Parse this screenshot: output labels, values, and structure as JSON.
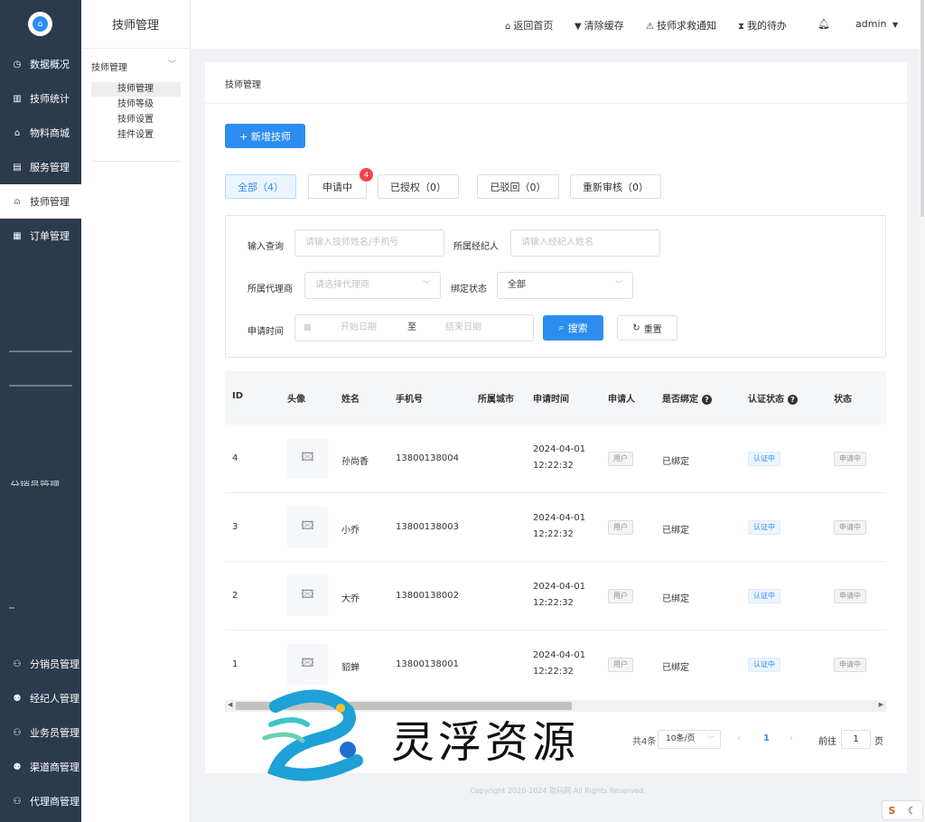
{
  "sidebar": {
    "items": [
      {
        "icon": "dashboard-icon",
        "glyph": "◷",
        "label": "数据概况"
      },
      {
        "icon": "stats-icon",
        "glyph": "▥",
        "label": "技师统计"
      },
      {
        "icon": "shop-icon",
        "glyph": "⌂",
        "label": "物料商城"
      },
      {
        "icon": "service-icon",
        "glyph": "▤",
        "label": "服务管理"
      },
      {
        "icon": "technician-icon",
        "glyph": "⍝",
        "label": "技师管理"
      },
      {
        "icon": "order-icon",
        "glyph": "▦",
        "label": "订单管理"
      },
      {
        "icon": "distributor-icon",
        "glyph": "⚇",
        "label": "分销员管理"
      },
      {
        "icon": "broker-icon",
        "glyph": "⚉",
        "label": "经纪人管理"
      },
      {
        "icon": "salesman-icon",
        "glyph": "⚇",
        "label": "业务员管理"
      },
      {
        "icon": "channel-icon",
        "glyph": "⚉",
        "label": "渠道商管理"
      },
      {
        "icon": "agent-icon",
        "glyph": "⚇",
        "label": "代理商管理"
      }
    ],
    "partial_label": "分销员管理"
  },
  "submenu": {
    "title": "技师管理",
    "group": "技师管理",
    "items": [
      "技师管理",
      "技师等级",
      "技师设置",
      "挂件设置"
    ]
  },
  "header": {
    "home": "返回首页",
    "clear_cache": "清除缓存",
    "sos": "技师求救通知",
    "todo": "我的待办",
    "user": "admin"
  },
  "page": {
    "breadcrumb": "技师管理",
    "add_button": "+ 新增技师",
    "tabs": [
      "全部（4）",
      "申请中",
      "已授权（0）",
      "已驳回（0）",
      "重新审核（0）"
    ],
    "badge": "4"
  },
  "filters": {
    "query_label": "输入查询",
    "query_placeholder": "请输入技师姓名/手机号",
    "broker_label": "所属经纪人",
    "broker_placeholder": "请输入经纪人姓名",
    "agent_label": "所属代理商",
    "agent_placeholder": "请选择代理商",
    "bind_label": "绑定状态",
    "bind_value": "全部",
    "date_label": "申请时间",
    "start_placeholder": "开始日期",
    "date_sep": "至",
    "end_placeholder": "结束日期",
    "search_button": "搜索",
    "reset_button": "重置"
  },
  "table": {
    "headers": [
      "ID",
      "头像",
      "姓名",
      "手机号",
      "所属城市",
      "申请时间",
      "申请人",
      "是否绑定",
      "认证状态",
      "状态"
    ],
    "rows": [
      {
        "id": "4",
        "name": "孙尚香",
        "phone": "13800138004",
        "date": "2024-04-01",
        "time": "12:22:32",
        "applicant": "用户",
        "bound": "已绑定",
        "auth": "认证中",
        "status": "申请中"
      },
      {
        "id": "3",
        "name": "小乔",
        "phone": "13800138003",
        "date": "2024-04-01",
        "time": "12:22:32",
        "applicant": "用户",
        "bound": "已绑定",
        "auth": "认证中",
        "status": "申请中"
      },
      {
        "id": "2",
        "name": "大乔",
        "phone": "13800138002",
        "date": "2024-04-01",
        "time": "12:22:32",
        "applicant": "用户",
        "bound": "已绑定",
        "auth": "认证中",
        "status": "申请中"
      },
      {
        "id": "1",
        "name": "貂蝉",
        "phone": "13800138001",
        "date": "2024-04-01",
        "time": "12:22:32",
        "applicant": "用户",
        "bound": "已绑定",
        "auth": "认证中",
        "status": "申请中"
      }
    ]
  },
  "pagination": {
    "total_fragment": "共4条",
    "page_size": "10条/页",
    "current": "1",
    "goto_label": "前往",
    "goto_value": "1",
    "page_suffix": "页"
  },
  "footer": "Copyright 2020-2024 取码网 All Rights Reserved.",
  "watermark": "灵浮资源",
  "colors": {
    "sidebar_bg": "#2b3a4d",
    "primary": "#2d8cf0",
    "badge": "#f5414d"
  }
}
